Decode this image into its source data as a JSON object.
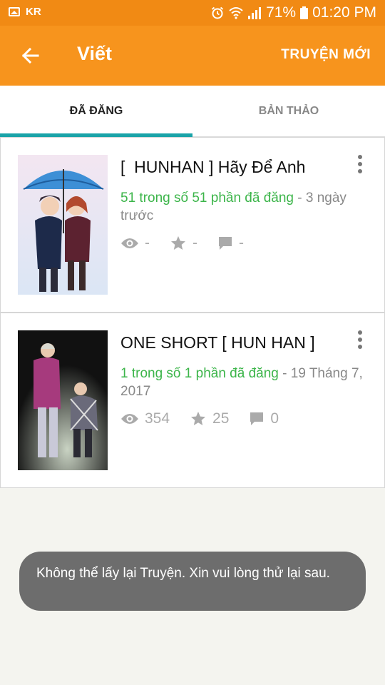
{
  "status_bar": {
    "carrier": "KR",
    "battery_percent": "71%",
    "time": "01:20 PM",
    "icons": [
      "image-icon",
      "alarm-icon",
      "wifi-icon",
      "signal-icon",
      "battery-icon"
    ]
  },
  "app_bar": {
    "title": "Viết",
    "back_icon": "arrow-left-icon",
    "new_story_label": "TRUYỆN MỚI"
  },
  "tabs": [
    {
      "label": "ĐÃ ĐĂNG",
      "active": true
    },
    {
      "label": "BẢN THẢO",
      "active": false
    }
  ],
  "stories": [
    {
      "title": "[  HUNHAN ] Hãy Để Anh",
      "parts": "51 trong số 51 phần đã đăng",
      "time": "- 3 ngày trước",
      "views": "-",
      "votes": "-",
      "comments": "-"
    },
    {
      "title": "ONE SHORT [ HUN HAN ]",
      "parts": "1 trong số 1 phần đã đăng",
      "time": "- 19 Tháng 7, 2017",
      "views": "354",
      "votes": "25",
      "comments": "0"
    }
  ],
  "toast": {
    "message": "Không thể lấy lại Truyện. Xin vui lòng thử lại sau."
  },
  "colors": {
    "app_bar": "#f7941d",
    "status_bar": "#f18a14",
    "tab_indicator": "#1aa3a8",
    "parts_text": "#3cb54a"
  }
}
